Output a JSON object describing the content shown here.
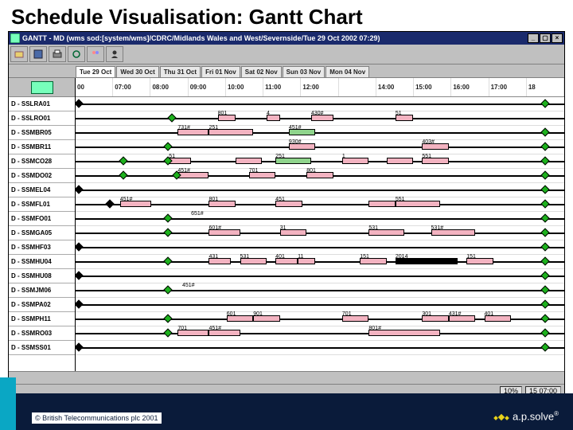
{
  "slide": {
    "title": "Schedule Visualisation: Gantt Chart"
  },
  "window": {
    "title": "GANTT - MD (wms sod:[system/wms]/CDRC/Midlands Wales and West/Severnside/Tue 29 Oct 2002 07:29)",
    "btn_min": "_",
    "btn_max": "▢",
    "btn_close": "×"
  },
  "tabs": [
    "Tue 29 Oct",
    "Wed 30 Oct",
    "Thu 31 Oct",
    "Fri 01 Nov",
    "Sat 02 Nov",
    "Sun 03 Nov",
    "Mon 04 Nov"
  ],
  "timescale": [
    "00",
    "07:00",
    "08:00",
    "09:00",
    "10:00",
    "11:00",
    "12:00",
    "",
    "14:00",
    "15:00",
    "16:00",
    "17:00",
    "18"
  ],
  "rows": [
    "D -   SSLRA01",
    "D -   SSLRO01",
    "D -   SSMBR05",
    "D -   SSMBR11",
    "D -   SSMCO28",
    "D -   SSMDO02",
    "D -   SSMEL04",
    "D -   SSMFL01",
    "D -   SSMFO01",
    "D -   SSMGA05",
    "D -   SSMHF03",
    "D -   SSMHU04",
    "D -   SSMHU08",
    "D -   SSMJM06",
    "D -   SSMPA02",
    "D -   SSMPH11",
    "D -   SSMRO03",
    "D -   SSMSS01"
  ],
  "status": {
    "zoom": "10%",
    "time": "15 07:00"
  },
  "footer": {
    "copyright": "© British Telecommunications plc 2001",
    "brand": "a.p.solve"
  },
  "chart_data": {
    "type": "table",
    "note": "Gantt-style schedule, one row per resource. x is hour-of-day (07:00–18:00). Bars are tasks; diamonds are milestones; black segments are current/marked intervals.",
    "x_range": [
      7,
      18
    ],
    "series": [
      {
        "row": 0,
        "line": [
          7,
          18
        ],
        "diamonds": [
          7,
          17.5
        ],
        "bars": [],
        "labels": []
      },
      {
        "row": 1,
        "line": [
          7,
          18
        ],
        "diamonds": [
          9.1
        ],
        "bars": [
          {
            "s": 10.2,
            "e": 10.6,
            "c": "pink",
            "t": "801"
          },
          {
            "s": 11.3,
            "e": 11.6,
            "c": "pink",
            "t": "4"
          },
          {
            "s": 12.3,
            "e": 12.8,
            "c": "pink",
            "t": "430#"
          },
          {
            "s": 14.2,
            "e": 14.6,
            "c": "pink",
            "t": "51"
          }
        ],
        "labels": []
      },
      {
        "row": 2,
        "line": [
          7,
          18
        ],
        "diamonds": [
          17.5
        ],
        "bars": [
          {
            "s": 9.3,
            "e": 10.0,
            "c": "pink",
            "t": "731#"
          },
          {
            "s": 10.0,
            "e": 11.0,
            "c": "pink",
            "t": "251"
          },
          {
            "s": 11.8,
            "e": 12.4,
            "c": "green",
            "t": "451#"
          }
        ],
        "labels": []
      },
      {
        "row": 3,
        "line": [
          7,
          18
        ],
        "diamonds": [
          9.0,
          17.5
        ],
        "bars": [
          {
            "s": 11.8,
            "e": 12.4,
            "c": "pink",
            "t": "930#"
          },
          {
            "s": 14.8,
            "e": 15.4,
            "c": "pink",
            "t": "403#"
          }
        ],
        "labels": []
      },
      {
        "row": 4,
        "line": [
          7,
          18
        ],
        "diamonds": [
          8.0,
          9.0,
          17.5
        ],
        "bars": [
          {
            "s": 9.1,
            "e": 9.6,
            "c": "pink",
            "t": "51"
          },
          {
            "s": 10.6,
            "e": 11.2,
            "c": "pink"
          },
          {
            "s": 11.5,
            "e": 12.3,
            "c": "green",
            "t": "251"
          },
          {
            "s": 13.0,
            "e": 13.6,
            "c": "pink",
            "t": "1"
          },
          {
            "s": 14.0,
            "e": 14.6,
            "c": "pink"
          },
          {
            "s": 14.8,
            "e": 15.4,
            "c": "pink",
            "t": "551"
          }
        ],
        "labels": []
      },
      {
        "row": 5,
        "line": [
          7,
          18
        ],
        "diamonds": [
          8.0,
          9.2,
          17.5
        ],
        "bars": [
          {
            "s": 9.3,
            "e": 10.0,
            "c": "pink",
            "t": "451#"
          },
          {
            "s": 10.9,
            "e": 11.5,
            "c": "pink",
            "t": "701"
          },
          {
            "s": 12.2,
            "e": 12.8,
            "c": "pink",
            "t": "801"
          }
        ],
        "labels": []
      },
      {
        "row": 6,
        "line": [
          7,
          18
        ],
        "diamonds": [
          7.0,
          17.5
        ],
        "bars": [],
        "labels": []
      },
      {
        "row": 7,
        "line": [
          7,
          18
        ],
        "diamonds": [
          7.7,
          17.5
        ],
        "bars": [
          {
            "s": 8.0,
            "e": 8.7,
            "c": "pink",
            "t": "451#"
          },
          {
            "s": 10.0,
            "e": 10.6,
            "c": "pink",
            "t": "801"
          },
          {
            "s": 11.5,
            "e": 12.1,
            "c": "pink",
            "t": "451"
          },
          {
            "s": 13.6,
            "e": 14.2,
            "c": "pink"
          },
          {
            "s": 14.2,
            "e": 15.2,
            "c": "pink",
            "t": "551"
          }
        ],
        "labels": []
      },
      {
        "row": 8,
        "line": [
          7,
          18
        ],
        "diamonds": [
          9.0,
          17.5
        ],
        "bars": [],
        "labels": [
          {
            "x": 9.6,
            "t": "651#"
          }
        ]
      },
      {
        "row": 9,
        "line": [
          7,
          18
        ],
        "diamonds": [
          9.0,
          17.5
        ],
        "bars": [
          {
            "s": 10.0,
            "e": 10.7,
            "c": "pink",
            "t": "601#"
          },
          {
            "s": 11.6,
            "e": 12.2,
            "c": "pink",
            "t": "31"
          },
          {
            "s": 13.6,
            "e": 14.4,
            "c": "pink",
            "t": "531"
          },
          {
            "s": 15.0,
            "e": 16.0,
            "c": "pink",
            "t": "531#"
          }
        ],
        "labels": []
      },
      {
        "row": 10,
        "line": [
          7,
          18
        ],
        "diamonds": [
          7.0,
          17.5
        ],
        "bars": [],
        "labels": []
      },
      {
        "row": 11,
        "line": [
          7,
          18
        ],
        "diamonds": [
          9.0,
          17.5
        ],
        "bars": [
          {
            "s": 10.0,
            "e": 10.5,
            "c": "pink",
            "t": "431"
          },
          {
            "s": 10.7,
            "e": 11.3,
            "c": "pink",
            "t": "531"
          },
          {
            "s": 11.5,
            "e": 12.0,
            "c": "pink",
            "t": "401"
          },
          {
            "s": 12.0,
            "e": 12.4,
            "c": "pink",
            "t": "11"
          },
          {
            "s": 13.4,
            "e": 14.0,
            "c": "pink",
            "t": "151"
          },
          {
            "s": 14.2,
            "e": 15.6,
            "c": "blk",
            "t": "2014"
          },
          {
            "s": 15.8,
            "e": 16.4,
            "c": "pink",
            "t": "151"
          }
        ],
        "labels": []
      },
      {
        "row": 12,
        "line": [
          7,
          18
        ],
        "diamonds": [
          7.0,
          17.5
        ],
        "bars": [],
        "labels": []
      },
      {
        "row": 13,
        "line": [
          7,
          18
        ],
        "diamonds": [
          9.0,
          17.5
        ],
        "bars": [],
        "labels": [
          {
            "x": 9.4,
            "t": "451#"
          }
        ]
      },
      {
        "row": 14,
        "line": [
          7,
          18
        ],
        "diamonds": [
          7.0,
          17.5
        ],
        "bars": [],
        "labels": []
      },
      {
        "row": 15,
        "line": [
          7,
          18
        ],
        "diamonds": [
          9.0,
          17.5
        ],
        "bars": [
          {
            "s": 10.4,
            "e": 11.0,
            "c": "pink",
            "t": "601"
          },
          {
            "s": 11.0,
            "e": 11.6,
            "c": "pink",
            "t": "901"
          },
          {
            "s": 13.0,
            "e": 13.6,
            "c": "pink",
            "t": "701"
          },
          {
            "s": 14.8,
            "e": 15.4,
            "c": "pink",
            "t": "301"
          },
          {
            "s": 15.4,
            "e": 16.0,
            "c": "pink",
            "t": "431#"
          },
          {
            "s": 16.2,
            "e": 16.8,
            "c": "pink",
            "t": "401"
          }
        ],
        "labels": []
      },
      {
        "row": 16,
        "line": [
          7,
          18
        ],
        "diamonds": [
          9.0,
          17.5
        ],
        "bars": [
          {
            "s": 9.3,
            "e": 10.0,
            "c": "pink",
            "t": "701"
          },
          {
            "s": 10.0,
            "e": 10.7,
            "c": "pink",
            "t": "451#"
          },
          {
            "s": 13.6,
            "e": 15.2,
            "c": "pink",
            "t": "801#"
          }
        ],
        "labels": []
      },
      {
        "row": 17,
        "line": [
          7,
          18
        ],
        "diamonds": [
          7.0,
          17.5
        ],
        "bars": [],
        "labels": []
      }
    ]
  }
}
